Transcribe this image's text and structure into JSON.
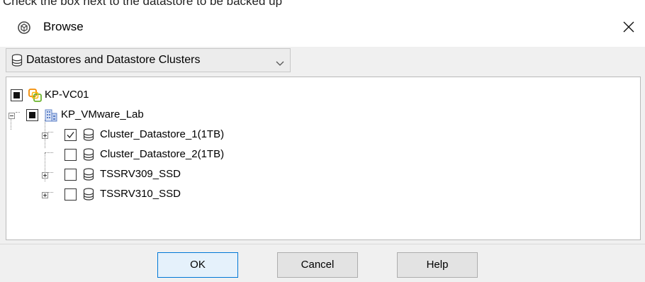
{
  "background_caption": "Check the box next to the datastore to be backed up",
  "dialog": {
    "title": "Browse",
    "close_glyph": "✕"
  },
  "dropdown": {
    "selected": "Datastores and Datastore Clusters",
    "icon": "datastore-icon"
  },
  "tree": {
    "root": {
      "label": "KP-VC01",
      "icon": "vcenter-icon",
      "checkbox": "mixed"
    },
    "datacenter": {
      "label": "KP_VMware_Lab",
      "icon": "datacenter-icon",
      "checkbox": "mixed",
      "expanded": true
    },
    "datastores": [
      {
        "label": "Cluster_Datastore_1(1TB)",
        "checkbox": "checked",
        "expander": "plus"
      },
      {
        "label": "Cluster_Datastore_2(1TB)",
        "checkbox": "unchecked",
        "expander": "none"
      },
      {
        "label": "TSSRV309_SSD",
        "checkbox": "unchecked",
        "expander": "plus"
      },
      {
        "label": "TSSRV310_SSD",
        "checkbox": "unchecked",
        "expander": "plus"
      }
    ]
  },
  "buttons": {
    "ok": "OK",
    "cancel": "Cancel",
    "help": "Help"
  },
  "colors": {
    "accent": "#0078d7",
    "vcenter_orange": "#f38b00",
    "vcenter_green": "#6bb42d",
    "datacenter_blue": "#5b7fc7"
  }
}
